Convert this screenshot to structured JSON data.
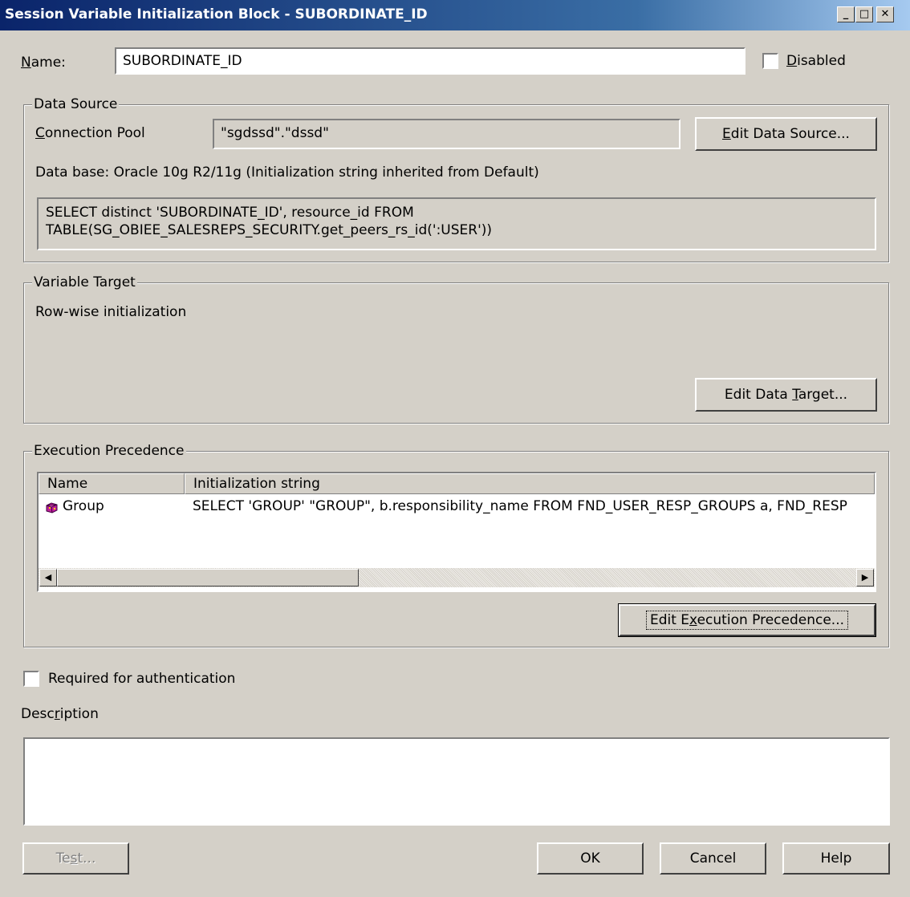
{
  "window": {
    "title": "Session Variable Initialization Block - SUBORDINATE_ID",
    "controls": {
      "minimize": "_",
      "maximize": "□",
      "close": "✕"
    }
  },
  "name": {
    "label_pre": "",
    "label_accel": "N",
    "label_post": "ame:",
    "value": "SUBORDINATE_ID"
  },
  "disabled": {
    "label_accel": "D",
    "label_post": "isabled",
    "checked": false
  },
  "data_source": {
    "legend": "Data Source",
    "connection_pool_accel": "C",
    "connection_pool_post": "onnection Pool",
    "connection_pool_value": "\"sgdssd\".\"dssd\"",
    "edit_button_accel": "E",
    "edit_button_post": "dit Data Source...",
    "database_info": "Data base: Oracle 10g R2/11g (Initialization string inherited from Default)",
    "sql_line1": "SELECT distinct 'SUBORDINATE_ID', resource_id FROM",
    "sql_line2": "TABLE(SG_OBIEE_SALESREPS_SECURITY.get_peers_rs_id(':USER'))"
  },
  "variable_target": {
    "legend": "Variable Target",
    "mode": "Row-wise initialization",
    "edit_button_pre": "Edit Data ",
    "edit_button_accel": "T",
    "edit_button_post": "arget..."
  },
  "execution_precedence": {
    "legend": "Execution Precedence",
    "columns": [
      "Name",
      "Initialization string"
    ],
    "rows": [
      {
        "icon": "group-icon",
        "name": "Group",
        "init_string": "SELECT   'GROUP' \"GROUP\", b.responsibility_name FROM FND_USER_RESP_GROUPS  a, FND_RESP"
      }
    ],
    "edit_button_pre": "Edit E",
    "edit_button_accel": "x",
    "edit_button_post": "ecution Precedence..."
  },
  "required_auth": {
    "label": "Required for authentication",
    "checked": false
  },
  "description": {
    "label_pre": "Desc",
    "label_accel": "r",
    "label_post": "iption",
    "value": ""
  },
  "buttons": {
    "test_pre": "Te",
    "test_accel": "s",
    "test_post": "t...",
    "ok": "OK",
    "cancel": "Cancel",
    "help": "Help"
  }
}
